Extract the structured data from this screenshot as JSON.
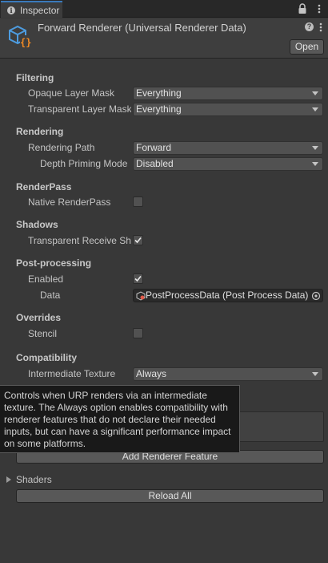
{
  "tab": {
    "label": "Inspector",
    "icon": "info-icon"
  },
  "header": {
    "title": "Forward Renderer (Universal Renderer Data)",
    "open_label": "Open",
    "asset_icon": "renderer-asset-icon"
  },
  "sections": {
    "filtering": {
      "title": "Filtering",
      "opaque_label": "Opaque Layer Mask",
      "opaque_value": "Everything",
      "transparent_label": "Transparent Layer Mask",
      "transparent_value": "Everything"
    },
    "rendering": {
      "title": "Rendering",
      "path_label": "Rendering Path",
      "path_value": "Forward",
      "depth_label": "Depth Priming Mode",
      "depth_value": "Disabled"
    },
    "renderpass": {
      "title": "RenderPass",
      "native_label": "Native RenderPass",
      "native_checked": false
    },
    "shadows": {
      "title": "Shadows",
      "receive_label": "Transparent Receive Shadows",
      "receive_checked": true
    },
    "postprocessing": {
      "title": "Post-processing",
      "enabled_label": "Enabled",
      "enabled_checked": true,
      "data_label": "Data",
      "data_value": "PostProcessData (Post Process Data)"
    },
    "overrides": {
      "title": "Overrides",
      "stencil_label": "Stencil",
      "stencil_checked": false
    },
    "compatibility": {
      "title": "Compatibility",
      "intermediate_label": "Intermediate Texture",
      "intermediate_value": "Always"
    }
  },
  "tooltip": {
    "text": "Controls when URP renders via an intermediate texture. The Always option enables compatibility with renderer features that do not declare their needed inputs, but can have a significant performance impact on some platforms."
  },
  "add_feature_label": "Add Renderer Feature",
  "shaders_label": "Shaders",
  "reload_label": "Reload All",
  "colors": {
    "tab_accent": "#3a79bb",
    "background": "#383838",
    "asset_icon_blue": "#4d9ce0",
    "asset_icon_orange": "#f08a24"
  }
}
